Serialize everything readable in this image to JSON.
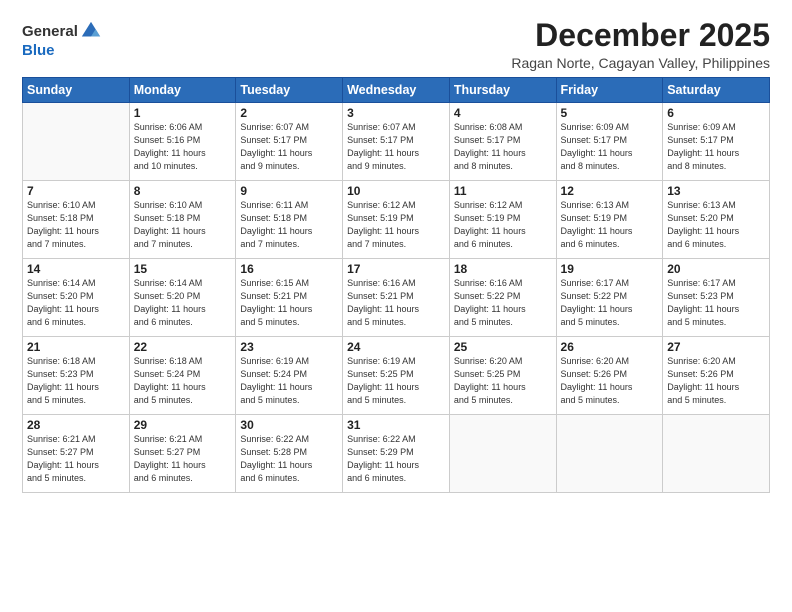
{
  "logo": {
    "general": "General",
    "blue": "Blue"
  },
  "title": "December 2025",
  "location": "Ragan Norte, Cagayan Valley, Philippines",
  "weekdays": [
    "Sunday",
    "Monday",
    "Tuesday",
    "Wednesday",
    "Thursday",
    "Friday",
    "Saturday"
  ],
  "weeks": [
    [
      {
        "day": "",
        "sunrise": "",
        "sunset": "",
        "daylight": ""
      },
      {
        "day": "1",
        "sunrise": "6:06 AM",
        "sunset": "5:16 PM",
        "daylight": "11 hours and 10 minutes."
      },
      {
        "day": "2",
        "sunrise": "6:07 AM",
        "sunset": "5:17 PM",
        "daylight": "11 hours and 9 minutes."
      },
      {
        "day": "3",
        "sunrise": "6:07 AM",
        "sunset": "5:17 PM",
        "daylight": "11 hours and 9 minutes."
      },
      {
        "day": "4",
        "sunrise": "6:08 AM",
        "sunset": "5:17 PM",
        "daylight": "11 hours and 8 minutes."
      },
      {
        "day": "5",
        "sunrise": "6:09 AM",
        "sunset": "5:17 PM",
        "daylight": "11 hours and 8 minutes."
      },
      {
        "day": "6",
        "sunrise": "6:09 AM",
        "sunset": "5:17 PM",
        "daylight": "11 hours and 8 minutes."
      }
    ],
    [
      {
        "day": "7",
        "sunrise": "6:10 AM",
        "sunset": "5:18 PM",
        "daylight": "11 hours and 7 minutes."
      },
      {
        "day": "8",
        "sunrise": "6:10 AM",
        "sunset": "5:18 PM",
        "daylight": "11 hours and 7 minutes."
      },
      {
        "day": "9",
        "sunrise": "6:11 AM",
        "sunset": "5:18 PM",
        "daylight": "11 hours and 7 minutes."
      },
      {
        "day": "10",
        "sunrise": "6:12 AM",
        "sunset": "5:19 PM",
        "daylight": "11 hours and 7 minutes."
      },
      {
        "day": "11",
        "sunrise": "6:12 AM",
        "sunset": "5:19 PM",
        "daylight": "11 hours and 6 minutes."
      },
      {
        "day": "12",
        "sunrise": "6:13 AM",
        "sunset": "5:19 PM",
        "daylight": "11 hours and 6 minutes."
      },
      {
        "day": "13",
        "sunrise": "6:13 AM",
        "sunset": "5:20 PM",
        "daylight": "11 hours and 6 minutes."
      }
    ],
    [
      {
        "day": "14",
        "sunrise": "6:14 AM",
        "sunset": "5:20 PM",
        "daylight": "11 hours and 6 minutes."
      },
      {
        "day": "15",
        "sunrise": "6:14 AM",
        "sunset": "5:20 PM",
        "daylight": "11 hours and 6 minutes."
      },
      {
        "day": "16",
        "sunrise": "6:15 AM",
        "sunset": "5:21 PM",
        "daylight": "11 hours and 5 minutes."
      },
      {
        "day": "17",
        "sunrise": "6:16 AM",
        "sunset": "5:21 PM",
        "daylight": "11 hours and 5 minutes."
      },
      {
        "day": "18",
        "sunrise": "6:16 AM",
        "sunset": "5:22 PM",
        "daylight": "11 hours and 5 minutes."
      },
      {
        "day": "19",
        "sunrise": "6:17 AM",
        "sunset": "5:22 PM",
        "daylight": "11 hours and 5 minutes."
      },
      {
        "day": "20",
        "sunrise": "6:17 AM",
        "sunset": "5:23 PM",
        "daylight": "11 hours and 5 minutes."
      }
    ],
    [
      {
        "day": "21",
        "sunrise": "6:18 AM",
        "sunset": "5:23 PM",
        "daylight": "11 hours and 5 minutes."
      },
      {
        "day": "22",
        "sunrise": "6:18 AM",
        "sunset": "5:24 PM",
        "daylight": "11 hours and 5 minutes."
      },
      {
        "day": "23",
        "sunrise": "6:19 AM",
        "sunset": "5:24 PM",
        "daylight": "11 hours and 5 minutes."
      },
      {
        "day": "24",
        "sunrise": "6:19 AM",
        "sunset": "5:25 PM",
        "daylight": "11 hours and 5 minutes."
      },
      {
        "day": "25",
        "sunrise": "6:20 AM",
        "sunset": "5:25 PM",
        "daylight": "11 hours and 5 minutes."
      },
      {
        "day": "26",
        "sunrise": "6:20 AM",
        "sunset": "5:26 PM",
        "daylight": "11 hours and 5 minutes."
      },
      {
        "day": "27",
        "sunrise": "6:20 AM",
        "sunset": "5:26 PM",
        "daylight": "11 hours and 5 minutes."
      }
    ],
    [
      {
        "day": "28",
        "sunrise": "6:21 AM",
        "sunset": "5:27 PM",
        "daylight": "11 hours and 5 minutes."
      },
      {
        "day": "29",
        "sunrise": "6:21 AM",
        "sunset": "5:27 PM",
        "daylight": "11 hours and 6 minutes."
      },
      {
        "day": "30",
        "sunrise": "6:22 AM",
        "sunset": "5:28 PM",
        "daylight": "11 hours and 6 minutes."
      },
      {
        "day": "31",
        "sunrise": "6:22 AM",
        "sunset": "5:29 PM",
        "daylight": "11 hours and 6 minutes."
      },
      {
        "day": "",
        "sunrise": "",
        "sunset": "",
        "daylight": ""
      },
      {
        "day": "",
        "sunrise": "",
        "sunset": "",
        "daylight": ""
      },
      {
        "day": "",
        "sunrise": "",
        "sunset": "",
        "daylight": ""
      }
    ]
  ],
  "labels": {
    "sunrise": "Sunrise:",
    "sunset": "Sunset:",
    "daylight": "Daylight:"
  }
}
